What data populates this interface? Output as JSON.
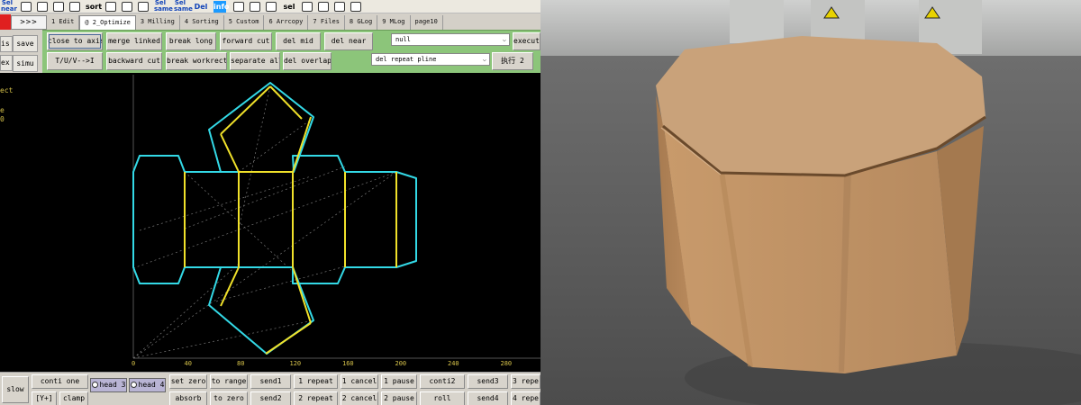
{
  "toolbar_icons": [
    {
      "label": "Sel\nnear",
      "icon": "select-near-icon"
    },
    {
      "label": "",
      "icon": "align-icon"
    },
    {
      "label": "",
      "icon": "mirror-icon"
    },
    {
      "label": "",
      "icon": "hash-icon"
    },
    {
      "label": "",
      "icon": "question-icon"
    },
    {
      "label": "sort",
      "icon": "sort-icon"
    },
    {
      "label": "",
      "icon": "curve-icon"
    },
    {
      "label": "",
      "icon": "rect-icon"
    },
    {
      "label": "",
      "icon": "shape-icon"
    },
    {
      "label": "Sel\nsame",
      "icon": "select-same-icon"
    },
    {
      "label": "Sel\nsame",
      "icon": "select-same2-icon"
    },
    {
      "label": "Del",
      "icon": "delete-icon"
    },
    {
      "label": "info",
      "icon": "info-icon"
    },
    {
      "label": "",
      "icon": "bracket-icon"
    },
    {
      "label": "",
      "icon": "bracket2-icon"
    },
    {
      "label": "",
      "icon": "arrow-icon"
    },
    {
      "label": "sel",
      "icon": "select-icon"
    },
    {
      "label": "",
      "icon": "step-icon"
    },
    {
      "label": "",
      "icon": "step2-icon"
    },
    {
      "label": "",
      "icon": "zigzag-icon"
    },
    {
      "label": "",
      "icon": "zigzag2-icon"
    }
  ],
  "nav_label": ">>>",
  "tabs": [
    "1 Edit",
    "@ 2_Optimize",
    "3 Milling",
    "4 Sorting",
    "5 Custom",
    "6 Arrcopy",
    "7 Files",
    "8 GLog",
    "9 MLog",
    "page10"
  ],
  "side_buttons": {
    "top": "is",
    "bottom": "ex"
  },
  "side_buttons2": {
    "save": "save",
    "simu": "simu"
  },
  "optimize": {
    "row1": [
      "close to axis",
      "merge linked",
      "break long",
      "forward cut",
      "del mid",
      "del near"
    ],
    "row2": [
      "T/U/V-->I",
      "backward cut",
      "break workrect",
      "separate all",
      "del overlap"
    ],
    "select1": "null",
    "select2": "del repeat pline",
    "execute": "execute",
    "run2": "执行 2"
  },
  "info_lines": [
    "ect",
    "",
    "e",
    "0"
  ],
  "ruler_ticks": [
    "0",
    "40",
    "80",
    "120",
    "160",
    "200",
    "240",
    "280"
  ],
  "bottom": {
    "slow": "slow",
    "y_plus": "[Y+]",
    "clamp": "clamp",
    "conti_one": "conti one",
    "head3": "head 3",
    "head4": "head 4",
    "set_zero": "set zero",
    "to_range": "to range",
    "absorb": "absorb",
    "to_zero": "to zero",
    "send1": "send1",
    "send2": "send2",
    "repeat1": "1 repeat",
    "repeat2": "2 repeat",
    "cancel1": "1 cancel",
    "cancel2": "2 cancel",
    "pause1": "1 pause",
    "pause2": "2 pause",
    "conti2": "conti2",
    "roll": "roll",
    "send3": "send3",
    "send4": "send4",
    "repeat3": "3 repe",
    "repeat4": "4 repe"
  },
  "colors": {
    "cut": "#33d9e6",
    "crease": "#f0e12a",
    "canvas": "#000000",
    "panel": "#8cc57a",
    "ruler_text": "#d6c24a"
  }
}
